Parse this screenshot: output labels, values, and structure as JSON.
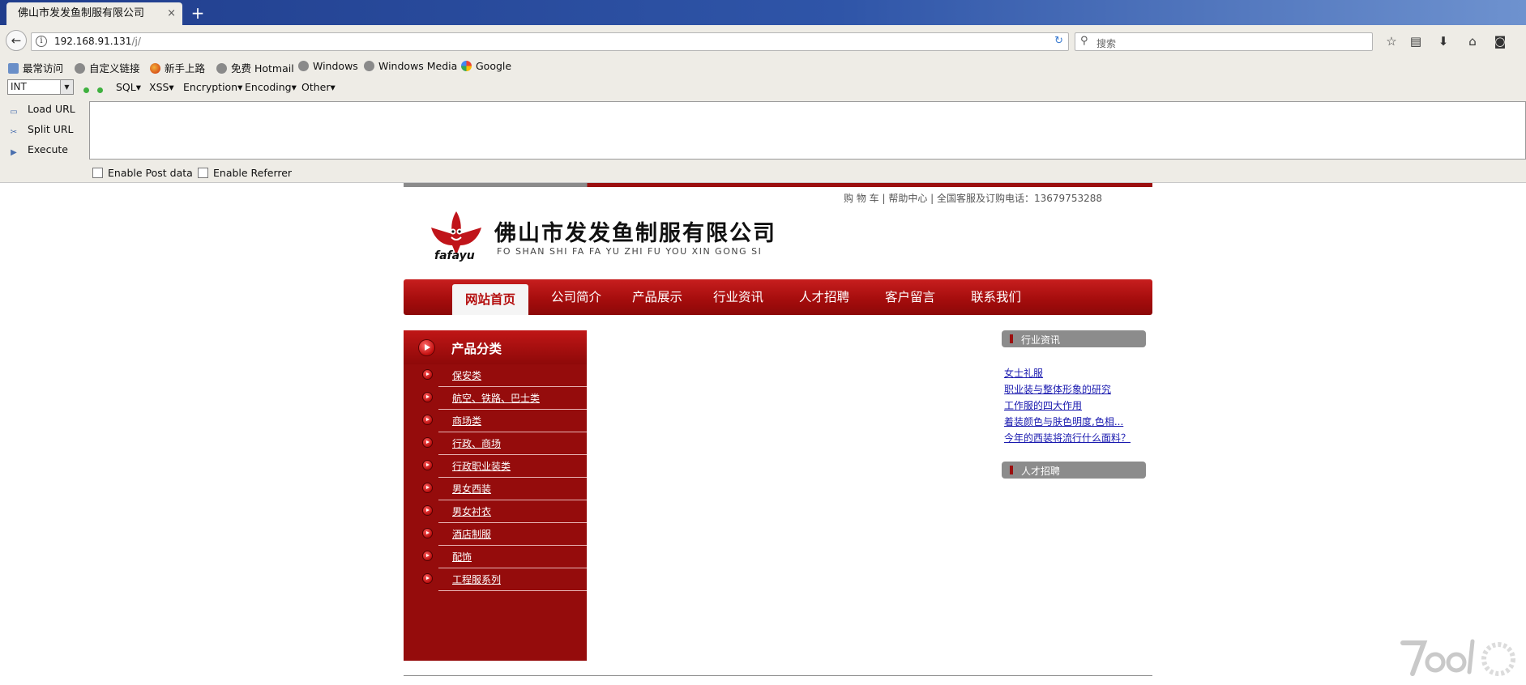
{
  "browser": {
    "tab_title": "佛山市发发鱼制服有限公司",
    "tab_close": "×",
    "new_tab": "+",
    "url_host": "192.168.91.131",
    "url_path": "/j/",
    "search_placeholder": "搜索",
    "bookmarks": [
      {
        "label": "最常访问",
        "icon": "sq"
      },
      {
        "label": "自定义链接",
        "icon": "globe"
      },
      {
        "label": "新手上路",
        "icon": "ff"
      },
      {
        "label": "免费 Hotmail",
        "icon": "globe"
      },
      {
        "label": "Windows",
        "icon": "globe"
      },
      {
        "label": "Windows Media",
        "icon": "globe"
      },
      {
        "label": "Google",
        "icon": "g"
      }
    ]
  },
  "hackbar": {
    "select_value": "INT",
    "menus": [
      "SQL▾",
      "XSS▾",
      "Encryption▾",
      "Encoding▾",
      "Other▾"
    ],
    "load_url": "Load URL",
    "split_url": "Split URL",
    "execute": "Execute",
    "post_data": "Enable Post data",
    "referrer": "Enable Referrer"
  },
  "site": {
    "top_links": "购 物 车 | 帮助中心 | 全国客服及订购电话：13679753288",
    "logo_text": "fafayu",
    "company_cn": "佛山市发发鱼制服有限公司",
    "company_pinyin": "FO SHAN SHI FA FA YU ZHI FU YOU XIN GONG SI",
    "nav": [
      "网站首页",
      "公司简介",
      "产品展示",
      "行业资讯",
      "人才招聘",
      "客户留言",
      "联系我们"
    ],
    "category_title": "产品分类",
    "categories": [
      "保安类",
      "航空、铁路、巴士类",
      "商场类",
      "行政、商场",
      "行政职业装类",
      "男女西装",
      "男女衬衣",
      "酒店制服",
      "配饰",
      "工程服系列"
    ],
    "news_title": "行业资讯",
    "news": [
      "女士礼服",
      "职业装与整体形象的研究",
      "工作服的四大作用",
      "着装颜色与肤色明度,色相...",
      "今年的西装将流行什么面料？"
    ],
    "jobs_title": "人才招聘"
  },
  "colors": {
    "brand_red": "#9b0f0f",
    "link_blue": "#1a1aaf"
  }
}
